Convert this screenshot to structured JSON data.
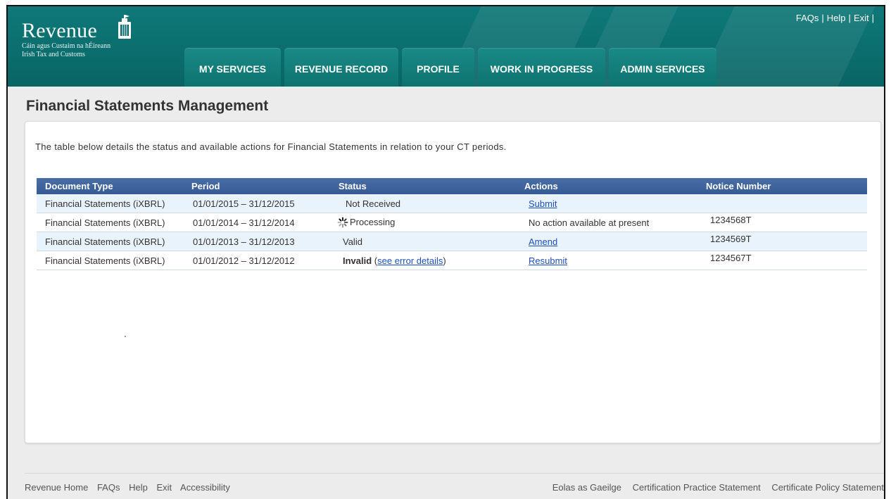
{
  "brand": {
    "name": "Revenue",
    "tagline_line1": "Cáin agus Custaim na hÉireann",
    "tagline_line2": "Irish Tax and Customs",
    "icon": "harp-icon"
  },
  "top_links": [
    "FAQs",
    "Help",
    "Exit"
  ],
  "nav": {
    "tabs": [
      {
        "label": "MY SERVICES"
      },
      {
        "label": "REVENUE RECORD"
      },
      {
        "label": "PROFILE"
      },
      {
        "label": "WORK IN PROGRESS"
      },
      {
        "label": "ADMIN SERVICES"
      }
    ]
  },
  "page": {
    "title": "Financial Statements Management",
    "intro": "The table below details the status and available actions for Financial Statements in relation to your CT periods."
  },
  "table": {
    "headers": [
      "Document Type",
      "Period",
      "Status",
      "Actions",
      "Notice Number"
    ],
    "rows": [
      {
        "document_type": "Financial Statements  (iXBRL)",
        "period": "01/01/2015 – 31/12/2015",
        "status": "Not Received",
        "action": "Submit",
        "action_is_link": true,
        "notice": ""
      },
      {
        "document_type": "Financial Statements (iXBRL)",
        "period": "01/01/2014 – 31/12/2014",
        "status": "Processing",
        "status_icon": "spinner-icon",
        "action": "No action available at present",
        "action_is_link": false,
        "notice": "1234568T"
      },
      {
        "document_type": "Financial Statements (iXBRL)",
        "period": "01/01/2013 – 31/12/2013",
        "status": "Valid",
        "action": "Amend",
        "action_is_link": true,
        "notice": "1234569T"
      },
      {
        "document_type": "Financial Statements (iXBRL)",
        "period": "01/01/2012 – 31/12/2012",
        "status": "Invalid",
        "status_link": "see error details",
        "action": "Resubmit",
        "action_is_link": true,
        "notice": "1234567T"
      }
    ]
  },
  "footer": {
    "left": [
      "Revenue Home",
      "FAQs",
      "Help",
      "Exit",
      "Accessibility"
    ],
    "right": [
      "Eolas as Gaeilge",
      "Certification Practice Statement",
      "Certificate Policy Statement"
    ]
  },
  "colors": {
    "header_teal": "#0b6d6d",
    "table_header_blue": "#3f64a0",
    "link_blue": "#1f4fbf",
    "row_alt": "#e8f3fb"
  }
}
